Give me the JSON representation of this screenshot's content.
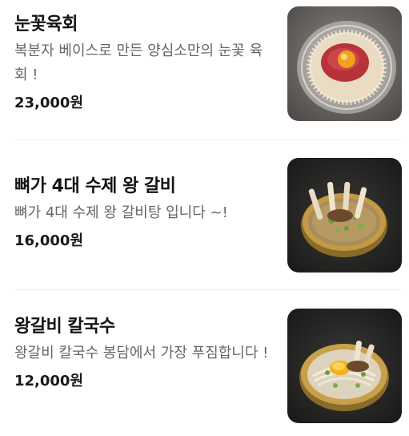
{
  "menu": {
    "items": [
      {
        "name": "눈꽃육회",
        "description": "복분자 베이스로 만든 양심소만의 눈꽃 육회 !",
        "price": "23,000원",
        "image_icon": "yukhoe-dish-icon"
      },
      {
        "name": "뼈가 4대 수제 왕 갈비",
        "description": "뼈가 4대 수제 왕 갈비탕 입니다 ~!",
        "price": "16,000원",
        "image_icon": "galbitang-dish-icon"
      },
      {
        "name": "왕갈비 칼국수",
        "description": "왕갈비 칼국수 봉담에서 가장 푸짐합니다 !",
        "price": "12,000원",
        "image_icon": "kalguksu-dish-icon"
      }
    ]
  }
}
